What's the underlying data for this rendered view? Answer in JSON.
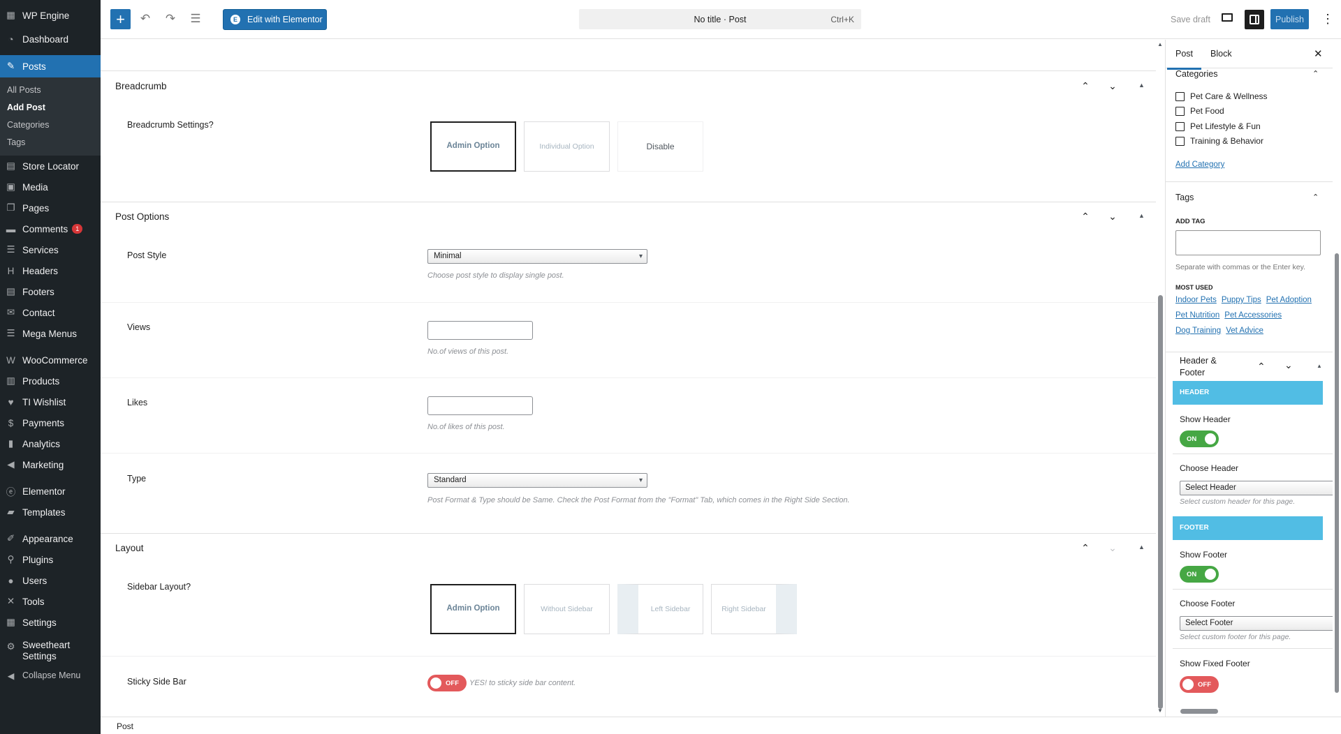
{
  "admin_menu": {
    "site_name": "WP Engine",
    "dashboard": "Dashboard",
    "posts": "Posts",
    "posts_sub": [
      "All Posts",
      "Add Post",
      "Categories",
      "Tags"
    ],
    "store_locator": "Store Locator",
    "media": "Media",
    "pages": "Pages",
    "comments": "Comments",
    "comments_count": "1",
    "services": "Services",
    "headers": "Headers",
    "footers": "Footers",
    "contact": "Contact",
    "mega_menus": "Mega Menus",
    "woocommerce": "WooCommerce",
    "products": "Products",
    "ti_wishlist": "TI Wishlist",
    "payments": "Payments",
    "analytics": "Analytics",
    "marketing": "Marketing",
    "elementor": "Elementor",
    "templates": "Templates",
    "appearance": "Appearance",
    "plugins": "Plugins",
    "users": "Users",
    "tools": "Tools",
    "settings": "Settings",
    "sweetheart_settings_line1": "Sweetheart",
    "sweetheart_settings_line2": "Settings",
    "collapse": "Collapse Menu"
  },
  "toolbar": {
    "edit_elementor": "Edit with Elementor",
    "command_title": "No title · Post",
    "command_shortcut": "Ctrl+K",
    "save_draft": "Save draft",
    "publish": "Publish"
  },
  "breadcrumb_section": {
    "title": "Breadcrumb",
    "field_label": "Breadcrumb Settings?",
    "options": [
      "Admin Option",
      "Individual Option",
      "Disable"
    ]
  },
  "post_options": {
    "title": "Post Options",
    "post_style_label": "Post Style",
    "post_style_value": "Minimal",
    "post_style_desc": "Choose post style to display single post.",
    "views_label": "Views",
    "views_desc": "No.of views of this post.",
    "likes_label": "Likes",
    "likes_desc": "No.of likes of this post.",
    "type_label": "Type",
    "type_value": "Standard",
    "type_desc": "Post Format & Type should be Same. Check the Post Format from the \"Format\" Tab, which comes in the Right Side Section."
  },
  "layout_section": {
    "title": "Layout",
    "sidebar_label": "Sidebar Layout?",
    "sidebar_options": [
      "Admin Option",
      "Without Sidebar",
      "Left Sidebar",
      "Right Sidebar"
    ],
    "sticky_label": "Sticky Side Bar",
    "sticky_toggle": "OFF",
    "sticky_desc": "YES! to sticky side bar content."
  },
  "footer_bar": {
    "breadcrumb": "Post"
  },
  "sidebar": {
    "tabs": [
      "Post",
      "Block"
    ],
    "categories_title": "Categories",
    "categories": [
      "Pet Care & Wellness",
      "Pet Food",
      "Pet Lifestyle & Fun",
      "Training & Behavior"
    ],
    "add_category": "Add Category",
    "tags_title": "Tags",
    "add_tag_label": "ADD TAG",
    "tag_help": "Separate with commas or the Enter key.",
    "most_used_label": "MOST USED",
    "most_used": [
      [
        "Indoor Pets",
        "Puppy Tips",
        "Pet Adoption"
      ],
      [
        "Pet Nutrition",
        "Pet Accessories"
      ],
      [
        "Dog Training",
        "Vet Advice"
      ]
    ],
    "hf_title_line1": "Header &",
    "hf_title_line2": "Footer",
    "header_band": "HEADER",
    "show_header": "Show Header",
    "show_header_toggle": "ON",
    "choose_header": "Choose Header",
    "header_select": "Select Header",
    "header_desc": "Select custom header for this page.",
    "footer_band": "FOOTER",
    "show_footer": "Show Footer",
    "show_footer_toggle": "ON",
    "choose_footer": "Choose Footer",
    "footer_select": "Select Footer",
    "footer_desc": "Select custom footer for this page.",
    "show_fixed_footer": "Show Fixed Footer",
    "fixed_footer_toggle": "OFF"
  },
  "colors": {
    "admin_bg": "#1d2327",
    "accent": "#2271b1",
    "band": "#51bde4",
    "toggle_on": "#46a744",
    "toggle_off": "#e3595b"
  }
}
